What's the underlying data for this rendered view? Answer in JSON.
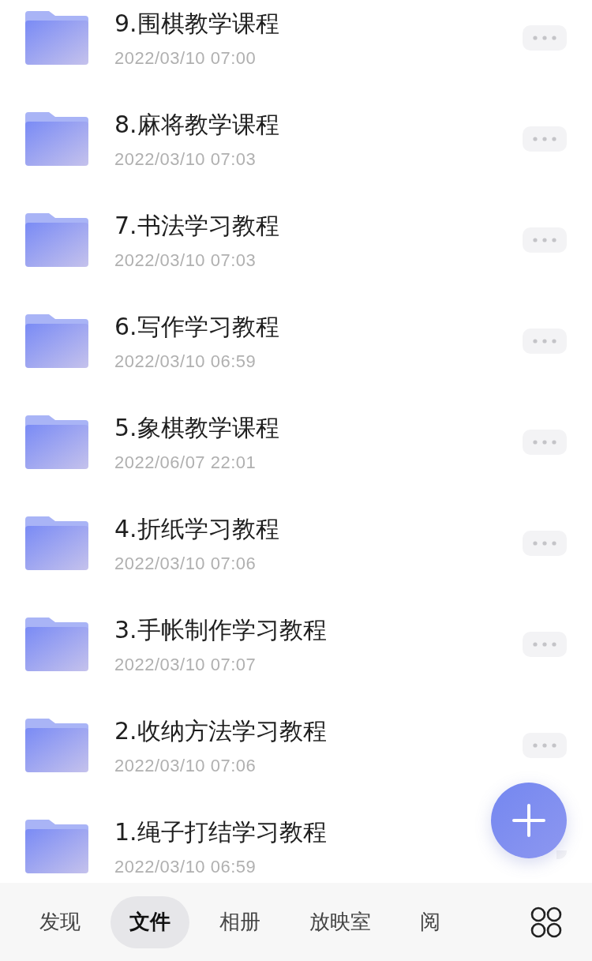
{
  "folders": [
    {
      "name": "9.围棋教学课程",
      "date": "2022/03/10 07:00"
    },
    {
      "name": "8.麻将教学课程",
      "date": "2022/03/10 07:03"
    },
    {
      "name": "7.书法学习教程",
      "date": "2022/03/10 07:03"
    },
    {
      "name": "6.写作学习教程",
      "date": "2022/03/10 06:59"
    },
    {
      "name": "5.象棋教学课程",
      "date": "2022/06/07 22:01"
    },
    {
      "name": "4.折纸学习教程",
      "date": "2022/03/10 07:06"
    },
    {
      "name": "3.手帐制作学习教程",
      "date": "2022/03/10 07:07"
    },
    {
      "name": "2.收纳方法学习教程",
      "date": "2022/03/10 07:06"
    },
    {
      "name": "1.绳子打结学习教程",
      "date": "2022/03/10 06:59"
    }
  ],
  "tabs": [
    {
      "label": "发现",
      "selected": false
    },
    {
      "label": "文件",
      "selected": true
    },
    {
      "label": "相册",
      "selected": false
    },
    {
      "label": "放映室",
      "selected": false
    },
    {
      "label": "阅",
      "selected": false
    }
  ]
}
